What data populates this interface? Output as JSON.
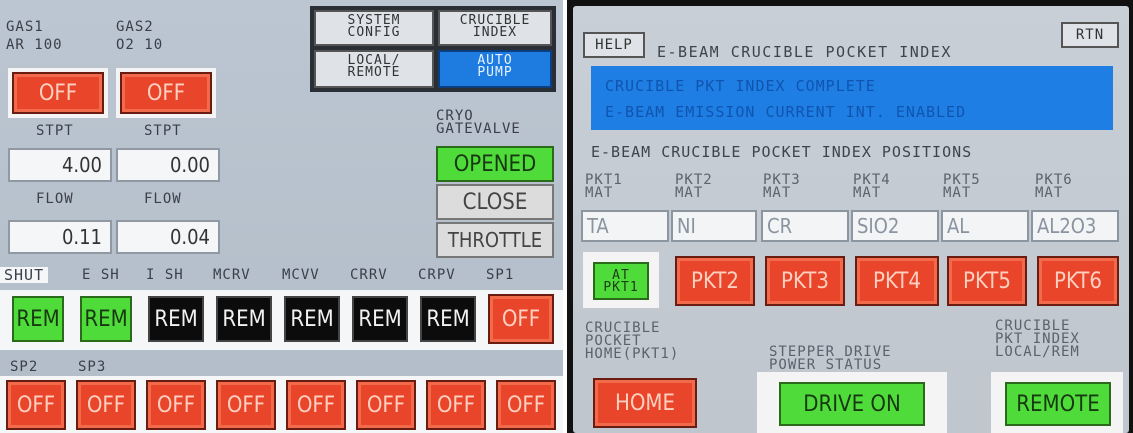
{
  "left_panel": {
    "gas1": {
      "title": "GAS1",
      "gas": "AR 100",
      "state": "OFF",
      "stpt_label": "STPT",
      "stpt_value": "4.00",
      "flow_label": "FLOW",
      "flow_value": "0.11"
    },
    "gas2": {
      "title": "GAS2",
      "gas": "O2 10",
      "state": "OFF",
      "stpt_label": "STPT",
      "stpt_value": "0.00",
      "flow_label": "FLOW",
      "flow_value": "0.04"
    },
    "system_config": "SYSTEM\nCONFIG",
    "crucible_index": "CRUCIBLE\nINDEX",
    "local_remote": "LOCAL/\nREMOTE",
    "auto_pump": "AUTO\nPUMP",
    "cryo_label": "CRYO\nGATEVALVE",
    "cryo_opened": "OPENED",
    "cryo_close": "CLOSE",
    "cryo_throttle": "THROTTLE",
    "row1_labels": [
      "SHUT",
      "E SH",
      "I SH",
      "MCRV",
      "MCVV",
      "CRRV",
      "CRPV",
      "SP1"
    ],
    "row1_buttons": [
      "REM",
      "REM",
      "REM",
      "REM",
      "REM",
      "REM",
      "REM",
      "OFF"
    ],
    "row2_labels": [
      "SP2",
      "SP3"
    ],
    "row2_buttons": [
      "OFF",
      "OFF",
      "OFF",
      "OFF",
      "OFF",
      "OFF",
      "OFF",
      "OFF"
    ]
  },
  "right_panel": {
    "help": "HELP",
    "title": "E-BEAM CRUCIBLE POCKET INDEX",
    "rtn": "RTN",
    "message_line1": "CRUCIBLE PKT INDEX COMPLETE",
    "message_line2": "E-BEAM EMISSION CURRENT INT. ENABLED",
    "positions_header": "E-BEAM CRUCIBLE POCKET INDEX POSITIONS",
    "pockets": [
      {
        "label": "PKT1\nMAT",
        "material": "TA",
        "button": "AT\nPKT1"
      },
      {
        "label": "PKT2\nMAT",
        "material": "NI",
        "button": "PKT2"
      },
      {
        "label": "PKT3\nMAT",
        "material": "CR",
        "button": "PKT3"
      },
      {
        "label": "PKT4\nMAT",
        "material": "SIO2",
        "button": "PKT4"
      },
      {
        "label": "PKT5\nMAT",
        "material": "AL",
        "button": "PKT5"
      },
      {
        "label": "PKT6\nMAT",
        "material": "AL2O3",
        "button": "PKT6"
      }
    ],
    "home_label": "CRUCIBLE\nPOCKET\nHOME(PKT1)",
    "home_button": "HOME",
    "stepper_label": "STEPPER DRIVE\nPOWER STATUS",
    "stepper_status": "DRIVE ON",
    "local_rem_label": "CRUCIBLE\nPKT INDEX\nLOCAL/REM",
    "local_rem_status": "REMOTE"
  }
}
